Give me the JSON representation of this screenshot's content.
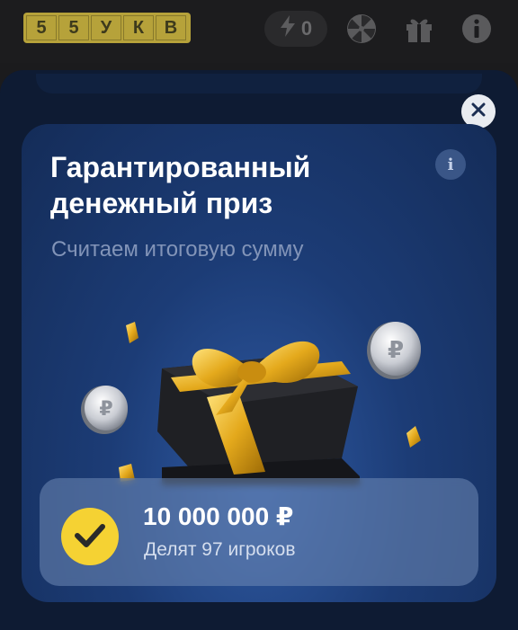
{
  "topbar": {
    "logo_letters": [
      "5",
      "5",
      "У",
      "К",
      "В"
    ],
    "energy_count": "0",
    "icons": [
      "lightning-icon",
      "wheel-icon",
      "gift-icon",
      "info-icon"
    ]
  },
  "modal": {
    "close_icon": "close-icon",
    "info_icon_text": "i",
    "title_line1": "Гарантированный",
    "title_line2": "денежный приз",
    "subtitle": "Считаем итоговую сумму",
    "prize": {
      "amount": "10 000 000 ₽",
      "note": "Делят 97 игроков",
      "badge_icon": "checkmark-icon"
    }
  },
  "colors": {
    "accent_yellow": "#f5d233",
    "card_blue": "#1c3c76",
    "logo_gold": "#b6a23a"
  }
}
